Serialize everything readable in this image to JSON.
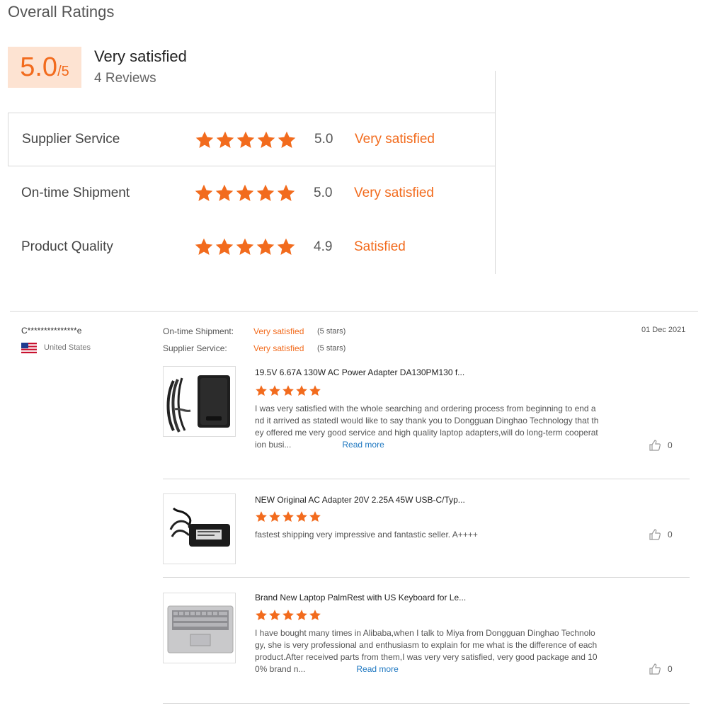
{
  "header": {
    "title": "Overall Ratings"
  },
  "overall": {
    "score": "5.0",
    "denominator": "/5",
    "label": "Very satisfied",
    "count": "4 Reviews"
  },
  "ratings": [
    {
      "label": "Supplier Service",
      "value": "5.0",
      "text": "Very satisfied",
      "stars": 5
    },
    {
      "label": "On-time Shipment",
      "value": "5.0",
      "text": "Very satisfied",
      "stars": 5
    },
    {
      "label": "Product Quality",
      "value": "4.9",
      "text": "Satisfied",
      "stars": 5
    }
  ],
  "review": {
    "reviewer": "C***************e",
    "country": "United States",
    "date": "01 Dec 2021",
    "shipment": {
      "label": "On-time Shipment:",
      "value": "Very satisfied",
      "stars": "(5 stars)"
    },
    "service": {
      "label": "Supplier Service:",
      "value": "Very satisfied",
      "stars": "(5 stars)"
    },
    "items": [
      {
        "title": "19.5V 6.67A 130W AC Power Adapter DA130PM130 f...",
        "stars": 5,
        "lines": [
          "I was very satisfied with the whole searching and ordering process from beginning to end a",
          "nd it arrived as statedI would like to say thank you to Dongguan Dinghao Technology that th",
          "ey offered me very good service and high quality laptop adapters,will do long-term cooperat",
          "ion busi..."
        ],
        "read_more": "Read more",
        "likes": "0"
      },
      {
        "title": "NEW Original AC Adapter 20V 2.25A 45W USB-C/Typ...",
        "stars": 5,
        "lines": [
          "fastest shipping very impressive and fantastic seller. A++++"
        ],
        "likes": "0"
      },
      {
        "title": "Brand New Laptop PalmRest with US Keyboard for Le...",
        "stars": 5,
        "lines": [
          "I have bought many times in Alibaba,when I talk to Miya from Dongguan Dinghao Technolo",
          "gy, she is very professional and enthusiasm to explain for me what is the difference of each",
          "product.After received parts from them,I was very very satisfied, very good package and 10",
          "0% brand n..."
        ],
        "read_more": "Read more",
        "likes": "0"
      }
    ]
  },
  "colors": {
    "accent": "#f26b1d",
    "score_bg": "#fde3d2",
    "link": "#1f78c1",
    "border": "#d8d8d8"
  },
  "icons": {
    "star": "star-icon",
    "like": "thumbs-up-icon",
    "flag": "us-flag-icon"
  }
}
